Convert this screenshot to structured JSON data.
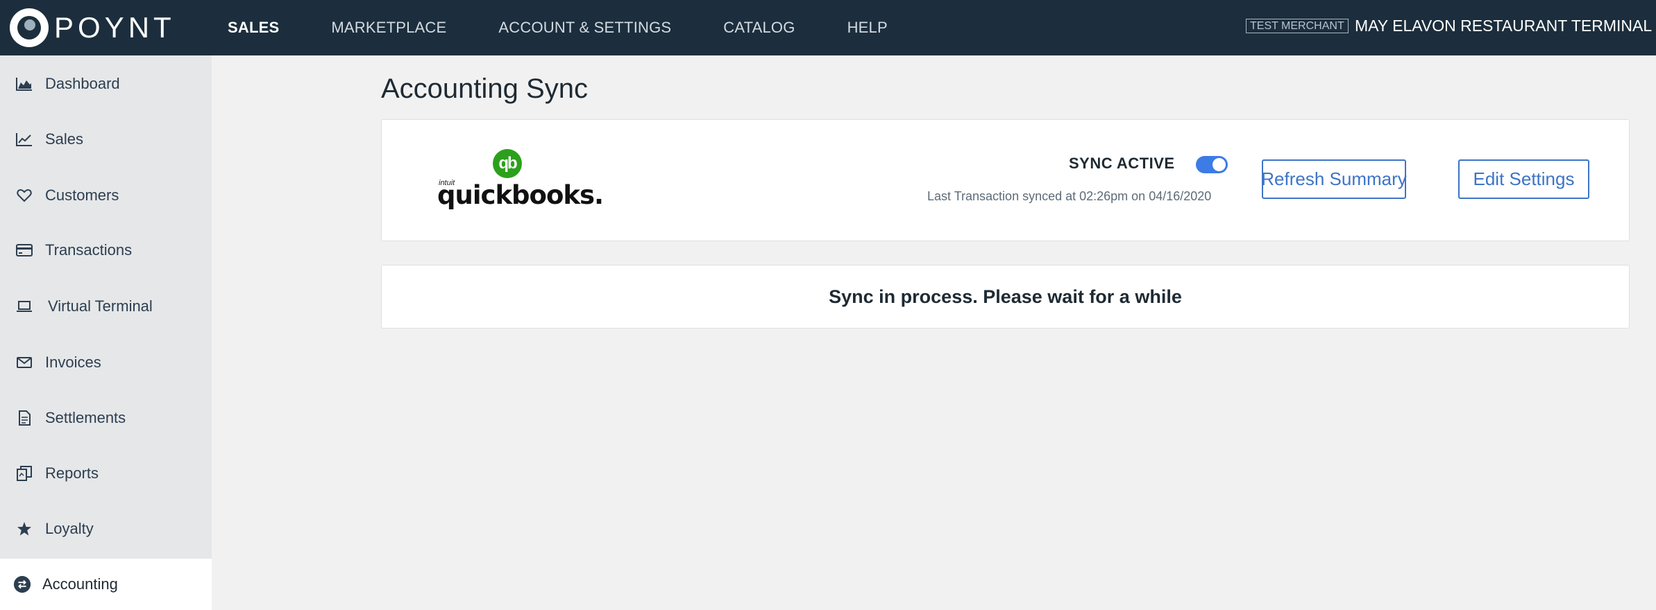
{
  "brand": {
    "name": "POYNT"
  },
  "topnav": {
    "items": [
      {
        "label": "SALES",
        "active": true
      },
      {
        "label": "MARKETPLACE",
        "active": false
      },
      {
        "label": "ACCOUNT & SETTINGS",
        "active": false
      },
      {
        "label": "CATALOG",
        "active": false
      },
      {
        "label": "HELP",
        "active": false
      }
    ],
    "merchant_badge": "TEST MERCHANT",
    "merchant_name": "MAY ELAVON RESTAURANT TERMINAL CAF"
  },
  "sidebar": {
    "items": [
      {
        "label": "Dashboard",
        "icon": "area-chart-icon"
      },
      {
        "label": "Sales",
        "icon": "line-chart-icon"
      },
      {
        "label": "Customers",
        "icon": "heart-icon"
      },
      {
        "label": "Transactions",
        "icon": "credit-card-icon"
      },
      {
        "label": "Virtual Terminal",
        "icon": "laptop-icon"
      },
      {
        "label": "Invoices",
        "icon": "envelope-icon"
      },
      {
        "label": "Settlements",
        "icon": "document-icon"
      },
      {
        "label": "Reports",
        "icon": "reports-icon"
      },
      {
        "label": "Loyalty",
        "icon": "star-icon"
      },
      {
        "label": "Accounting",
        "icon": "sync-icon",
        "active": true
      }
    ]
  },
  "main": {
    "page_title": "Accounting Sync",
    "integration": {
      "logo_brand_small": "intuit",
      "logo_word": "quickbooks.",
      "logo_mark": "qb",
      "sync_label": "SYNC ACTIVE",
      "sync_enabled": true,
      "last_sync": "Last Transaction synced at 02:26pm on 04/16/2020",
      "refresh_label": "Refresh Summary",
      "edit_label": "Edit Settings"
    },
    "status_message": "Sync in process. Please wait for a while"
  },
  "colors": {
    "topbar": "#1c2e3d",
    "sidebar": "#e6e7e9",
    "accent": "#3d74c7",
    "toggle_on": "#3d7be6",
    "quickbooks_green": "#2ca01c"
  }
}
